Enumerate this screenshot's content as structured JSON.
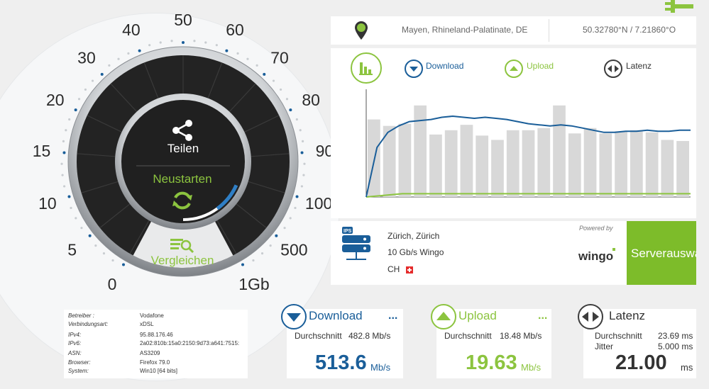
{
  "gauge": {
    "tick_labels": [
      "0",
      "5",
      "10",
      "15",
      "20",
      "30",
      "40",
      "50",
      "60",
      "70",
      "80",
      "90",
      "100",
      "500",
      "1Gb"
    ],
    "share_label": "Teilen",
    "restart_label": "Neustarten",
    "compare_label": "Vergleichen",
    "progress": 0.12,
    "colors": {
      "accent": "#8cc43f",
      "dial": "#232323",
      "progress": "#2f7fc6"
    }
  },
  "location": {
    "city": "Mayen, Rhineland-Palatinate, DE",
    "coords": "50.32780°N / 7.21860°O"
  },
  "graph": {
    "legend": {
      "download": "Download",
      "upload": "Upload",
      "latency": "Latenz"
    },
    "colors": {
      "download": "#1a5e99",
      "upload": "#8cc43f",
      "latency": "#3d3d3d",
      "bars": "#d8d8d8"
    },
    "bars": [
      0.72,
      0.66,
      0.68,
      0.85,
      0.58,
      0.62,
      0.67,
      0.57,
      0.53,
      0.62,
      0.62,
      0.64,
      0.85,
      0.59,
      0.64,
      0.59,
      0.61,
      0.62,
      0.6,
      0.53,
      0.52
    ],
    "download_line": [
      0,
      0.46,
      0.6,
      0.66,
      0.7,
      0.71,
      0.72,
      0.74,
      0.75,
      0.74,
      0.73,
      0.74,
      0.73,
      0.72,
      0.7,
      0.68,
      0.67,
      0.66,
      0.67,
      0.66,
      0.64,
      0.62,
      0.6,
      0.6,
      0.61,
      0.61,
      0.62,
      0.61,
      0.61,
      0.62,
      0.62
    ],
    "upload_line": [
      0,
      0.03,
      0.03,
      0.03,
      0.03,
      0.03,
      0.03,
      0.03,
      0.03,
      0.03
    ]
  },
  "server": {
    "city": "Zürich, Zürich",
    "provider": "10 Gb/s Wingo",
    "country": "CH",
    "powered_by": "Powered by",
    "logo": "wingo",
    "select_label": "Serverauswahl",
    "icon_badge": "IPS"
  },
  "info": [
    {
      "key": "Betreiber :",
      "value": "Vodafone"
    },
    {
      "key": "Verbindungsart:",
      "value": "xDSL"
    },
    {
      "key": "IPv4:",
      "value": "95.88.176.46"
    },
    {
      "key": "IPv6:",
      "value": "2a02:810b:15a0:2150:9d73:a641:7515:"
    },
    {
      "key": "ASN:",
      "value": "AS3209"
    },
    {
      "key": "Browser:",
      "value": "Firefox 79.0"
    },
    {
      "key": "System:",
      "value": "Win10 [64 bits]"
    }
  ],
  "results": {
    "download": {
      "title": "Download",
      "more": "...",
      "avg_label": "Durchschnitt",
      "avg_value": "482.8 Mb/s",
      "value": "513.6",
      "unit": "Mb/s",
      "color": "#1a5e99"
    },
    "upload": {
      "title": "Upload",
      "more": "...",
      "avg_label": "Durchschnitt",
      "avg_value": "18.48 Mb/s",
      "value": "19.63",
      "unit": "Mb/s",
      "color": "#8cc43f"
    },
    "latency": {
      "title": "Latenz",
      "avg_label": "Durchschnitt",
      "avg_value": "23.69 ms",
      "jitter_label": "Jitter",
      "jitter_value": "5.000 ms",
      "value": "21.00",
      "unit": "ms",
      "color": "#3d3d3d"
    }
  }
}
